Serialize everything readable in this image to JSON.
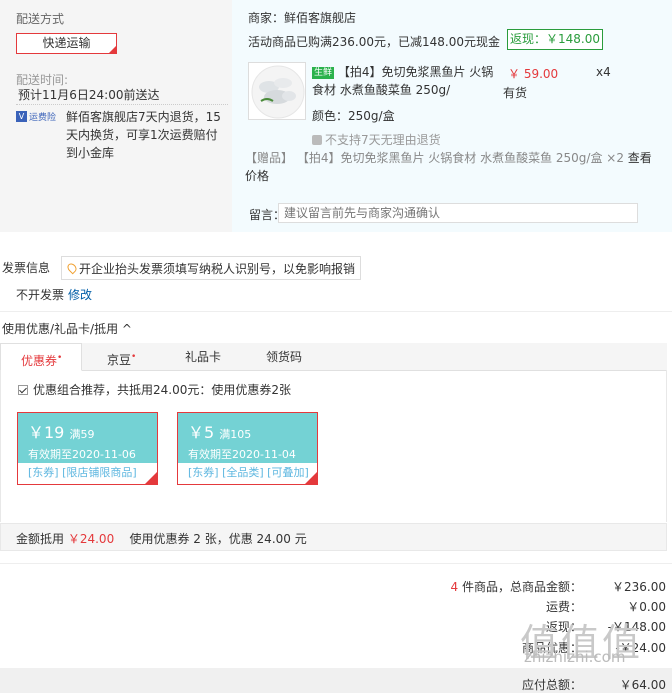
{
  "shipping": {
    "title": "配送方式",
    "method": "快递运输",
    "time_label": "配送时间:",
    "time_value": "预计11月6日24:00前送达",
    "insurance_badge": "运费险",
    "insurance_text": "鲜佰客旗舰店7天内退货，15天内换货，可享1次运费赔付到小金库"
  },
  "product": {
    "shop": "商家：鲜佰客旗舰店",
    "promo": "活动商品已购满236.00元，已减148.00元现金",
    "cashback": "返现：￥148.00",
    "fresh_tag": "生鲜",
    "title": "【拍4】免切免浆黑鱼片 火锅食材 水煮鱼酸菜鱼 250g/",
    "price": "￥ 59.00",
    "qty": "x4",
    "stock": "有货",
    "spec": "颜色：250g/盒",
    "no_return": "不支持7天无理由退货",
    "gift": "【赠品】 【拍4】免切免浆黑鱼片 火锅食材 水煮鱼酸菜鱼 250g/盒 ×2",
    "gift_link": "查看价格",
    "message_label": "留言：",
    "message_placeholder": "建议留言前先与商家沟通确认"
  },
  "invoice": {
    "label": "发票信息",
    "tip": "开企业抬头发票须填写纳税人识别号，以免影响报销",
    "value": "不开发票",
    "edit": "修改"
  },
  "coupons": {
    "header": "使用优惠/礼品卡/抵用",
    "tabs": [
      "优惠券",
      "京豆",
      "礼品卡",
      "领货码"
    ],
    "combo_text": "优惠组合推荐，共抵用24.00元：使用优惠券2张",
    "items": [
      {
        "amount": "￥19",
        "cond": "满59",
        "expiry": "有效期至2020-11-06",
        "scope": "[东券] [限店铺限商品]"
      },
      {
        "amount": "￥5",
        "cond": "满105",
        "expiry": "有效期至2020-11-04",
        "scope": "[东券] [全品类] [可叠加]"
      }
    ],
    "summary_label": "金额抵用",
    "summary_amount": "￥24.00",
    "summary_text": "使用优惠券 2 张，优惠 24.00 元"
  },
  "totals": {
    "count_num": "4",
    "count_text": "件商品，总商品金额：",
    "goods_value": "￥236.00",
    "shipping_label": "运费：",
    "shipping_value": "￥0.00",
    "cashback_label": "返现：",
    "cashback_value": "-￥148.00",
    "coupon_label": "商品优惠：",
    "coupon_value": "-￥24.00",
    "payable_label": "应付总额：",
    "payable_value": "￥64.00"
  },
  "watermark": {
    "text": "值值值",
    "url": "zhizhizhi.com"
  }
}
